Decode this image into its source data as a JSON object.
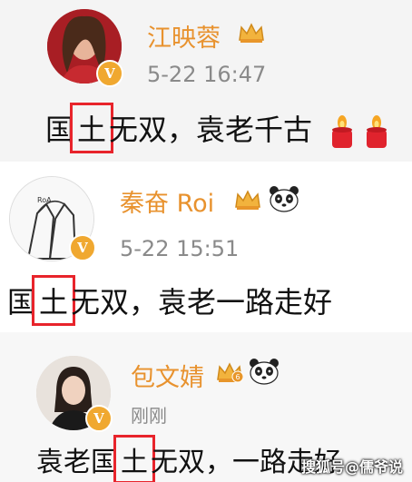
{
  "posts": [
    {
      "username": "江映蓉",
      "timestamp": "5-22 16:47",
      "content": [
        "国",
        "土",
        "无双，袁老千古"
      ],
      "highlight": "土",
      "badge": "V",
      "emojis": [
        "candle-emoji",
        "candle-emoji"
      ]
    },
    {
      "username": "秦奋 Roi",
      "timestamp": "5-22 15:51",
      "content": [
        "国",
        "土",
        "无双，袁老一路走好"
      ],
      "highlight": "土",
      "badge": "V",
      "emojis": [
        "crown-icon",
        "panda-emoji"
      ]
    },
    {
      "username": "包文婧",
      "timestamp": "刚刚",
      "content": [
        "袁老国",
        "土",
        "无双，一路走好"
      ],
      "highlight": "土",
      "badge": "V",
      "emojis": [
        "crown-level-6-icon",
        "panda-emoji"
      ],
      "crown_level": "6"
    }
  ],
  "watermark": "搜狐号@儒爷说",
  "colors": {
    "username": "#e8922e",
    "highlight_box": "#e8242b",
    "badge": "#f0a830"
  }
}
